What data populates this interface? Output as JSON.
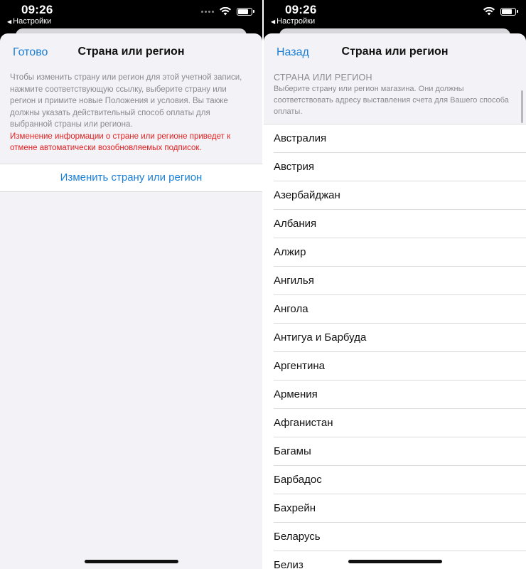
{
  "left_screen": {
    "status_bar": {
      "time": "09:26",
      "back_app": "Настройки"
    },
    "nav": {
      "left_button": "Готово",
      "title": "Страна или регион"
    },
    "info_text": "Чтобы изменить страну или регион для этой учетной записи, нажмите соответствующую ссылку, выберите страну или регион и примите новые Положения и условия. Вы также должны указать действительный способ оплаты для выбранной страны или региона.",
    "warning_text": "Изменение информации о стране или регионе приведет к отмене автоматически возобновляемых подписок.",
    "action_button": "Изменить страну или регион"
  },
  "right_screen": {
    "status_bar": {
      "time": "09:26",
      "back_app": "Настройки"
    },
    "nav": {
      "left_button": "Назад",
      "title": "Страна или регион"
    },
    "section_title": "СТРАНА ИЛИ РЕГИОН",
    "section_description": "Выберите страну или регион магазина. Они должны соответствовать адресу выставления счета для Вашего способа оплаты.",
    "countries": [
      "Австралия",
      "Австрия",
      "Азербайджан",
      "Албания",
      "Алжир",
      "Ангилья",
      "Ангола",
      "Антигуа и Барбуда",
      "Аргентина",
      "Армения",
      "Афганистан",
      "Багамы",
      "Барбадос",
      "Бахрейн",
      "Беларусь",
      "Белиз"
    ]
  },
  "colors": {
    "accent": "#1a7fd6",
    "warning": "#e32222",
    "sheet_background": "#f2f2f7"
  }
}
